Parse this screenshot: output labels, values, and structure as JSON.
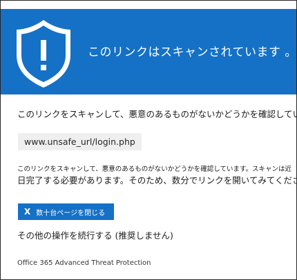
{
  "banner": {
    "title": "このリンクはスキャンされています 。",
    "icon": "shield-exclamation-icon",
    "background_color": "#1471c6"
  },
  "message": {
    "line1": "このリンクをスキャンして、悪意のあるものがないかどうかを確認しています。",
    "url": "www.unsafe_url/login.php",
    "paragraph_small": "このリンクをスキャンして、悪意のあるものがないかどうかを確認しています。スキャンは近",
    "paragraph_large": "日完了する必要があります。そのため、数分でリンクを開いてみてください。"
  },
  "actions": {
    "close_icon_text": "X",
    "close_label": "数十台ページを閉じる",
    "continue_label": "その他の操作を続行する (推奨しません)"
  },
  "footer": {
    "product": "Office 365 Advanced Threat Protection"
  }
}
